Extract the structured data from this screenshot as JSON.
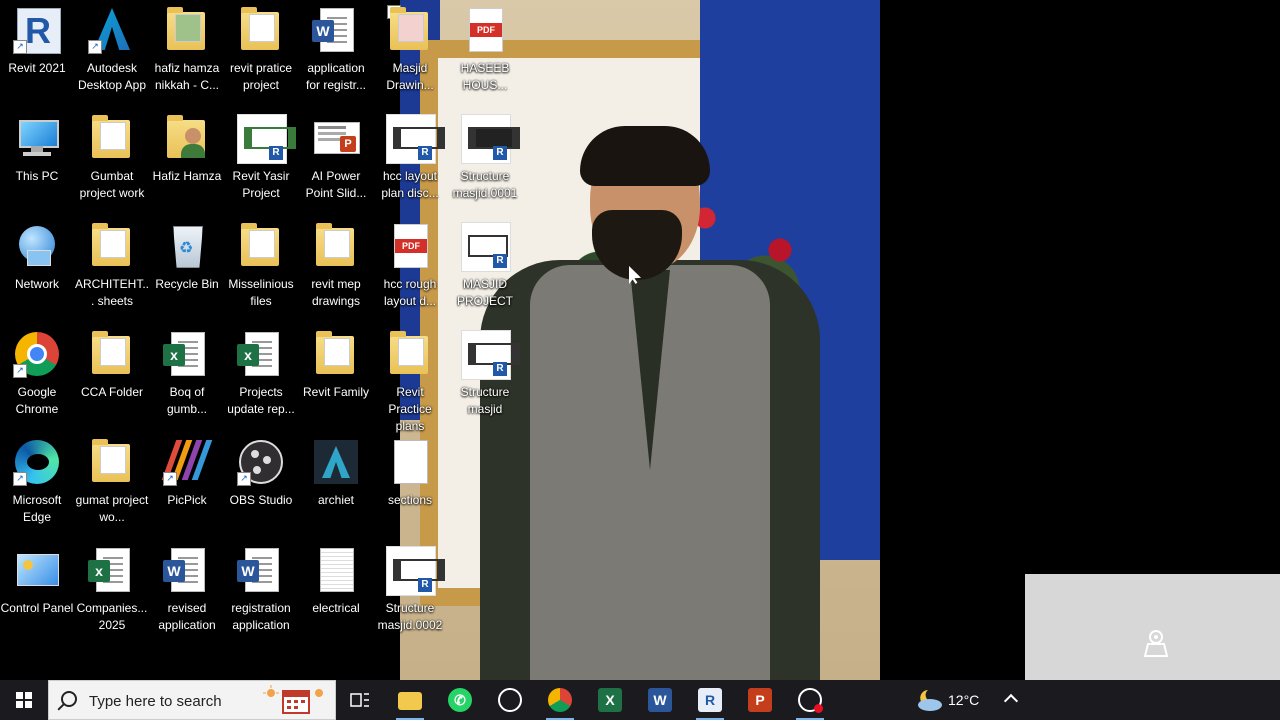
{
  "desktop": {
    "icons": [
      {
        "id": "revit2021",
        "label": "Revit 2021"
      },
      {
        "id": "autodesk",
        "label": "Autodesk Desktop App"
      },
      {
        "id": "hafizhamza-nikkah",
        "label": "hafiz hamza nikkah - C..."
      },
      {
        "id": "revit-pratice",
        "label": "revit pratice project"
      },
      {
        "id": "application-reg",
        "label": "application for registr..."
      },
      {
        "id": "masjid-drawing",
        "label": "Masjid Drawin..."
      },
      {
        "id": "haseeb-hous",
        "label": "HASEEB HOUS..."
      },
      {
        "id": "this-pc",
        "label": "This PC"
      },
      {
        "id": "gumbat-project",
        "label": "Gumbat project work"
      },
      {
        "id": "hafiz-hamza",
        "label": "Hafiz Hamza"
      },
      {
        "id": "revit-yasir",
        "label": "Revit Yasir Project"
      },
      {
        "id": "ai-powerpoint",
        "label": "AI Power Point Slid..."
      },
      {
        "id": "hcc-layout",
        "label": "hcc layout plan disc..."
      },
      {
        "id": "structure-0001",
        "label": "Structure masjid.0001"
      },
      {
        "id": "network",
        "label": "Network"
      },
      {
        "id": "architeht-sheets",
        "label": "ARCHITEHT... sheets"
      },
      {
        "id": "recycle-bin",
        "label": "Recycle Bin"
      },
      {
        "id": "misselinious",
        "label": "Misselinious files"
      },
      {
        "id": "revit-mep",
        "label": "revit mep drawings"
      },
      {
        "id": "hcc-rough",
        "label": "hcc rough layout d..."
      },
      {
        "id": "masjid-project",
        "label": "MASJID PROJECT"
      },
      {
        "id": "chrome",
        "label": "Google Chrome"
      },
      {
        "id": "cca-folder",
        "label": "CCA Folder"
      },
      {
        "id": "boq",
        "label": "Boq of gumb..."
      },
      {
        "id": "projects-update",
        "label": "Projects update rep..."
      },
      {
        "id": "revit-family",
        "label": "Revit Family"
      },
      {
        "id": "revit-practice-plans",
        "label": "Revit Practice plans"
      },
      {
        "id": "structure-masjid",
        "label": "Structure masjid"
      },
      {
        "id": "edge",
        "label": "Microsoft Edge"
      },
      {
        "id": "gumat-project",
        "label": "gumat project wo..."
      },
      {
        "id": "picpick",
        "label": "PicPick"
      },
      {
        "id": "obs",
        "label": "OBS Studio"
      },
      {
        "id": "archiet",
        "label": "archiet"
      },
      {
        "id": "sections",
        "label": "sections"
      },
      {
        "id": "control-panel",
        "label": "Control Panel"
      },
      {
        "id": "companies-2025",
        "label": "Companies... 2025"
      },
      {
        "id": "revised-application",
        "label": "revised application"
      },
      {
        "id": "registration-application",
        "label": "registration application"
      },
      {
        "id": "electrical",
        "label": "electrical"
      },
      {
        "id": "structure-0002",
        "label": "Structure masjid.0002"
      }
    ]
  },
  "taskbar": {
    "search_placeholder": "Type here to search",
    "apps": [
      "Task View",
      "File Explorer",
      "WhatsApp",
      "ChatGPT",
      "Google Chrome",
      "Excel",
      "Word",
      "Revit",
      "PowerPoint",
      "Screen Recorder"
    ],
    "temperature": "12°C"
  },
  "colors": {
    "taskbar_bg": "#1b1b1f",
    "accent": "#7eb4ea",
    "revit_blue": "#2159a8",
    "excel_green": "#1e7145",
    "word_blue": "#2b579a",
    "ppt_red": "#c43e1c"
  }
}
